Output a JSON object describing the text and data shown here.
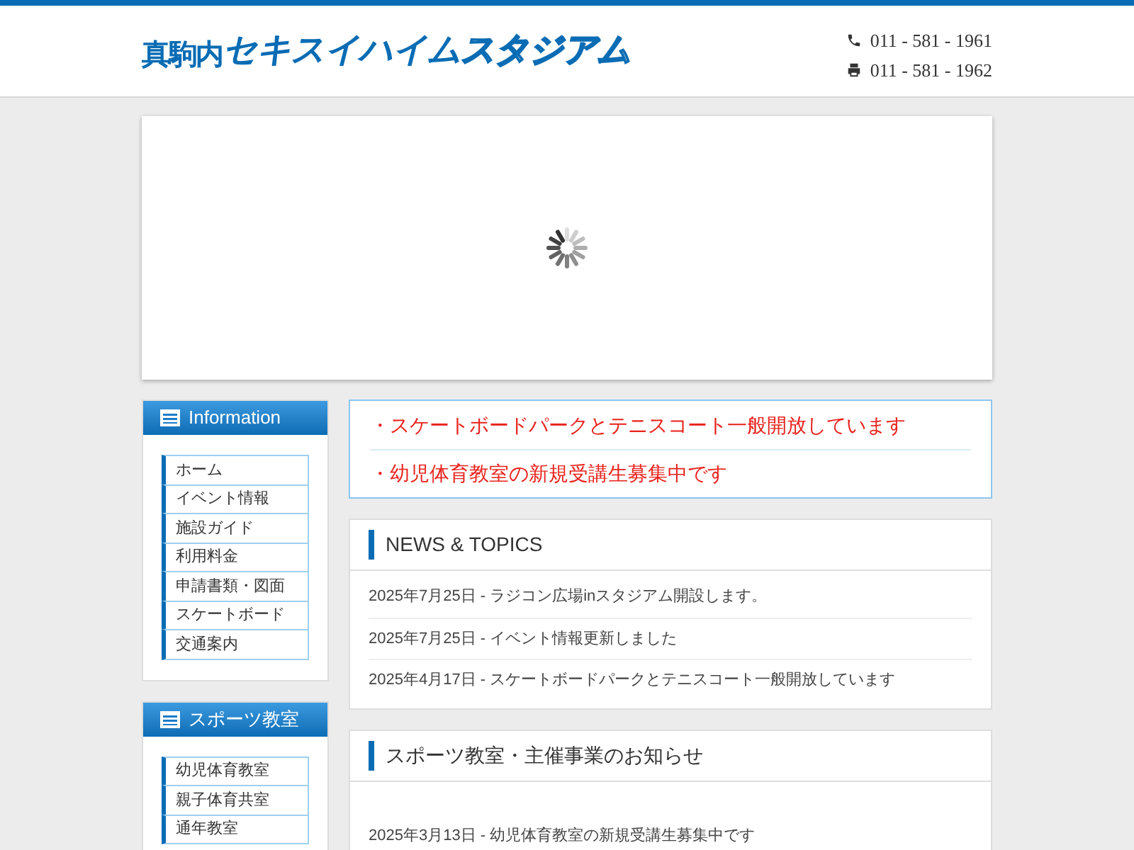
{
  "header": {
    "logo": {
      "prefix": "真駒内",
      "name": "セキスイハイム",
      "suffix": "スタジアム"
    },
    "contacts": [
      {
        "kind": "phone",
        "number": "011 - 581 - 1961"
      },
      {
        "kind": "fax",
        "number": "011 - 581 - 1962"
      }
    ]
  },
  "sidebar": [
    {
      "title": "Information",
      "items": [
        "ホーム",
        "イベント情報",
        "施設ガイド",
        "利用料金",
        "申請書類・図面",
        "スケートボード",
        "交通案内"
      ]
    },
    {
      "title": "スポーツ教室",
      "items": [
        "幼児体育教室",
        "親子体育共室",
        "通年教室"
      ]
    }
  ],
  "notices": [
    "・スケートボードパークとテニスコート一般開放しています",
    "・幼児体育教室の新規受講生募集中です"
  ],
  "panels": [
    {
      "title": "NEWS & TOPICS",
      "entries": [
        "2025年7月25日 - ラジコン広場inスタジアム開設します。",
        "2025年7月25日 - イベント情報更新しました",
        "2025年4月17日 - スケートボードパークとテニスコート一般開放しています"
      ]
    },
    {
      "title": "スポーツ教室・主催事業のお知らせ",
      "entries": [
        "2025年3月13日 - 幼児体育教室の新規受講生募集中です"
      ]
    }
  ]
}
